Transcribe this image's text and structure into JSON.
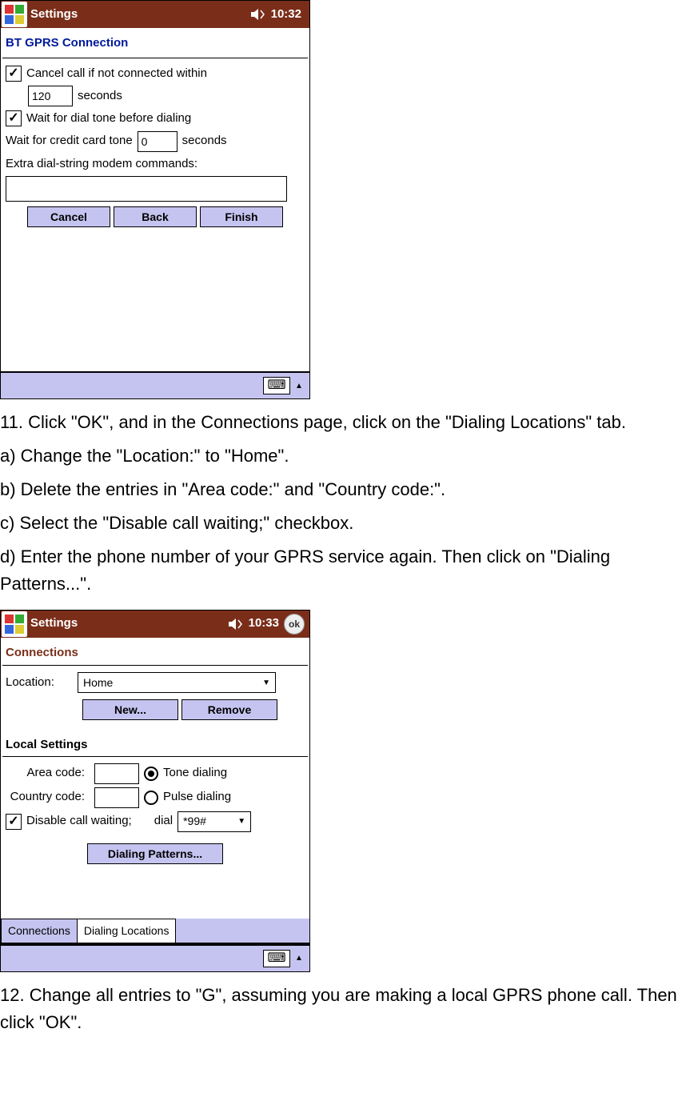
{
  "screen1": {
    "statusbar": {
      "title": "Settings",
      "time": "10:32"
    },
    "page_title": "BT GPRS Connection",
    "cancel_call_label": "Cancel call if not connected within",
    "timeout_value": "120",
    "seconds_label": "seconds",
    "wait_dial_tone_label": "Wait for dial tone before dialing",
    "wait_credit_label_a": "Wait for credit card tone",
    "wait_credit_value": "0",
    "wait_credit_label_b": "seconds",
    "extra_dial_label": "Extra dial-string modem commands:",
    "extra_dial_value": "",
    "buttons": {
      "cancel": "Cancel",
      "back": "Back",
      "finish": "Finish"
    }
  },
  "instructions1": {
    "step11": "11. Click \"OK\", and in the Connections page, click on the \"Dialing Locations\" tab.",
    "a": "a) Change the \"Location:\" to \"Home\".",
    "b": "b) Delete the entries in \"Area code:\" and \"Country code:\".",
    "c": "c) Select the \"Disable call waiting;\" checkbox.",
    "d": "d) Enter the phone number of your GPRS service again. Then click on \"Dialing Patterns...\"."
  },
  "screen2": {
    "statusbar": {
      "title": "Settings",
      "time": "10:33",
      "ok": "ok"
    },
    "page_title": "Connections",
    "location_label": "Location:",
    "location_value": "Home",
    "buttons": {
      "new": "New...",
      "remove": "Remove",
      "dialing_patterns": "Dialing Patterns..."
    },
    "local_settings_title": "Local Settings",
    "area_code_label": "Area code:",
    "area_code_value": "",
    "country_code_label": "Country code:",
    "country_code_value": "",
    "tone_dialing_label": "Tone dialing",
    "pulse_dialing_label": "Pulse dialing",
    "disable_call_waiting_label": "Disable call waiting;",
    "dial_label": "dial",
    "dial_value": "*99#",
    "tabs": {
      "connections": "Connections",
      "dialing": "Dialing Locations"
    }
  },
  "instructions2": {
    "step12": "12. Change all entries to \"G\", assuming you are making a local GPRS phone call. Then click \"OK\"."
  }
}
